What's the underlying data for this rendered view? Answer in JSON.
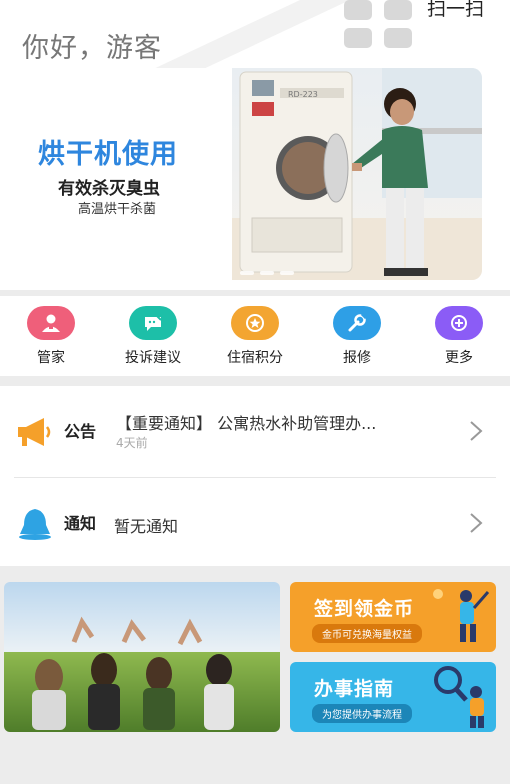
{
  "header": {
    "greeting": "你好，游客",
    "scan_label": "扫一扫"
  },
  "banner": {
    "title": "烘干机使用",
    "subtitle1": "有效杀灭臭虫",
    "subtitle2": "高温烘干杀菌",
    "machine_label": "RD-223"
  },
  "menu": {
    "items": [
      {
        "label": "管家",
        "icon": "butler-icon",
        "color": "#ef5f7a"
      },
      {
        "label": "投诉建议",
        "icon": "complaint-icon",
        "color": "#1dbfa8"
      },
      {
        "label": "住宿积分",
        "icon": "points-icon",
        "color": "#f3a531"
      },
      {
        "label": "报修",
        "icon": "wrench-icon",
        "color": "#2e9fe6"
      },
      {
        "label": "更多",
        "icon": "more-icon",
        "color": "#8b5cf6"
      }
    ]
  },
  "announcement": {
    "title": "公告",
    "text": "【重要通知】 公寓热水补助管理办...",
    "time": "4天前",
    "icon": "megaphone-icon"
  },
  "notification": {
    "title": "通知",
    "text": "暂无通知",
    "icon": "bell-icon"
  },
  "cards": {
    "checkin": {
      "title": "签到领金币",
      "pill": "金币可兑换海量权益"
    },
    "guide": {
      "title": "办事指南",
      "pill": "为您提供办事流程"
    }
  },
  "colors": {
    "accent_blue": "#2e86de",
    "orange": "#f5a02a",
    "cyan": "#36b6e8"
  }
}
